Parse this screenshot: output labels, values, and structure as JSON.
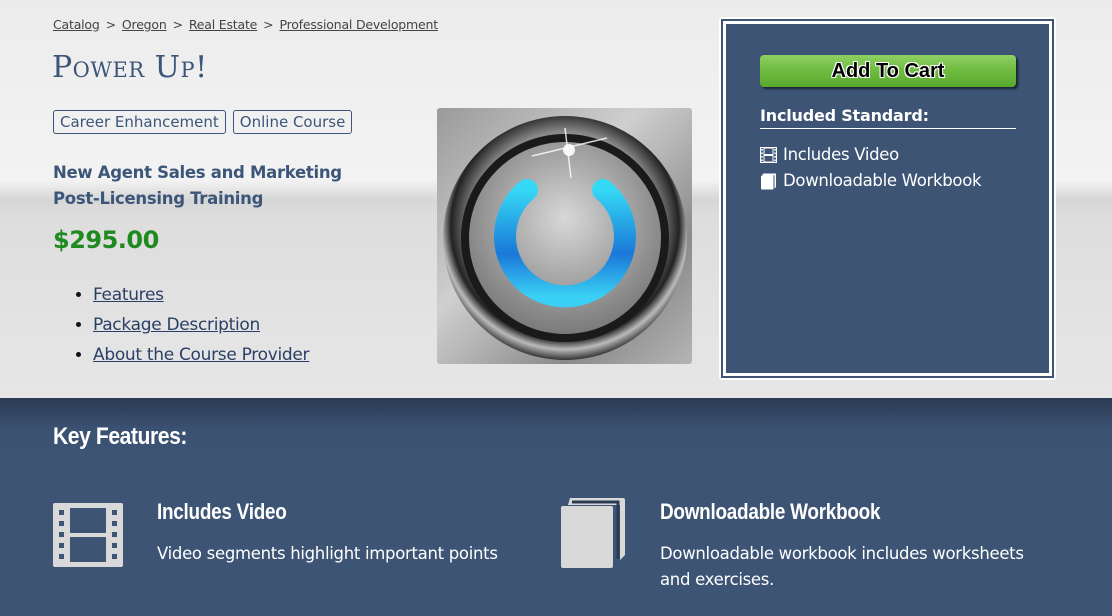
{
  "breadcrumb": [
    {
      "label": "Catalog"
    },
    {
      "label": "Oregon"
    },
    {
      "label": "Real Estate"
    },
    {
      "label": "Professional Development"
    }
  ],
  "breadcrumb_separator": ">",
  "product": {
    "title": "Power Up!",
    "tags": [
      "Career Enhancement",
      "Online Course"
    ],
    "subtitle": "New Agent Sales and Marketing Post-Licensing Training",
    "price": "$295.00",
    "links": [
      "Features",
      "Package Description",
      "About the Course Provider"
    ],
    "image_icon": "power-button-icon"
  },
  "sidebar": {
    "cart_button": "Add To Cart",
    "included_title": "Included Standard:",
    "included": [
      {
        "icon": "film-icon",
        "label": "Includes Video"
      },
      {
        "icon": "book-icon",
        "label": "Downloadable Workbook"
      }
    ]
  },
  "key_features": {
    "title": "Key Features:",
    "items": [
      {
        "icon": "film-icon",
        "name": "Includes Video",
        "description": "Video segments highlight important points"
      },
      {
        "icon": "book-icon",
        "name": "Downloadable Workbook",
        "description": "Downloadable workbook includes worksheets and exercises."
      }
    ]
  },
  "colors": {
    "brand_navy": "#3d5474",
    "price_green": "#1f8a1f",
    "cart_green": "#6dbb3f"
  }
}
